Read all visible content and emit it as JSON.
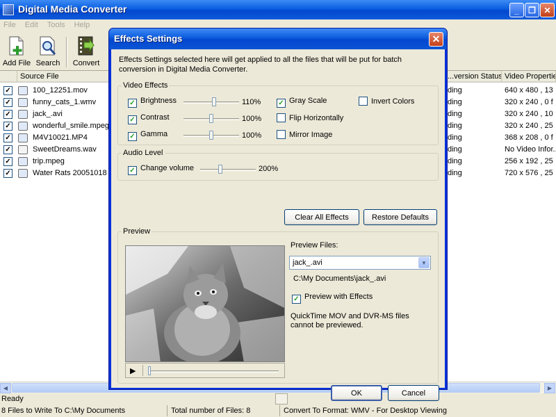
{
  "app": {
    "title": "Digital Media Converter",
    "menu": [
      "File",
      "Edit",
      "Tools",
      "Help"
    ],
    "toolbar": [
      {
        "label": "Add File",
        "icon": "add-file-icon"
      },
      {
        "label": "Search",
        "icon": "search-icon"
      },
      {
        "label": "Convert",
        "icon": "convert-icon"
      }
    ],
    "list_columns": [
      "Source File",
      "...version Status",
      "Video Propertie..."
    ],
    "files": [
      {
        "name": "100_12251.mov",
        "status": "ding",
        "props": "640 x 480 , 13"
      },
      {
        "name": "funny_cats_1.wmv",
        "status": "ding",
        "props": "320 x 240 , 0 f"
      },
      {
        "name": "jack_.avi",
        "status": "ding",
        "props": "320 x 240 , 10"
      },
      {
        "name": "wonderful_smile.mpeg",
        "status": "ding",
        "props": "320 x 240 , 25"
      },
      {
        "name": "M4V10021.MP4",
        "status": "ding",
        "props": "368 x 208 , 0 f"
      },
      {
        "name": "SweetDreams.wav",
        "status": "ding",
        "props": "No Video Infor..."
      },
      {
        "name": "trip.mpeg",
        "status": "ding",
        "props": "256 x 192 , 25"
      },
      {
        "name": "Water Rats 20051018",
        "status": "ding",
        "props": "720 x 576 , 25"
      }
    ],
    "status": {
      "ready": "Ready",
      "files_to": "8 Files to Write To C:\\My Documents",
      "total": "Total number of Files: 8",
      "format": "Convert To Format: WMV - For Desktop Viewing"
    }
  },
  "dialog": {
    "title": "Effects Settings",
    "description": "Effects Settings selected here will get applied to all the files that will be put for batch conversion in Digital Media Converter.",
    "video_effects": {
      "legend": "Video Effects",
      "sliders": [
        {
          "label": "Brightness",
          "checked": true,
          "value": "110%",
          "level": 0.55
        },
        {
          "label": "Contrast",
          "checked": true,
          "value": "100%",
          "level": 0.5
        },
        {
          "label": "Gamma",
          "checked": true,
          "value": "100%",
          "level": 0.5
        }
      ],
      "toggles": [
        {
          "label": "Gray Scale",
          "checked": true
        },
        {
          "label": "Flip Horizontally",
          "checked": false
        },
        {
          "label": "Mirror Image",
          "checked": false
        },
        {
          "label": "Invert Colors",
          "checked": false
        }
      ]
    },
    "audio": {
      "legend": "Audio Level",
      "label": "Change volume",
      "checked": true,
      "value": "200%",
      "level": 0.5
    },
    "clear_btn": "Clear All Effects",
    "restore_btn": "Restore Defaults",
    "preview": {
      "legend": "Preview",
      "files_label": "Preview Files:",
      "selected": "jack_.avi",
      "path": "C:\\My Documents\\jack_.avi",
      "with_effects": "Preview with Effects",
      "with_effects_checked": true,
      "note": "QuickTime MOV and DVR-MS files cannot be previewed."
    },
    "ok": "OK",
    "cancel": "Cancel"
  }
}
